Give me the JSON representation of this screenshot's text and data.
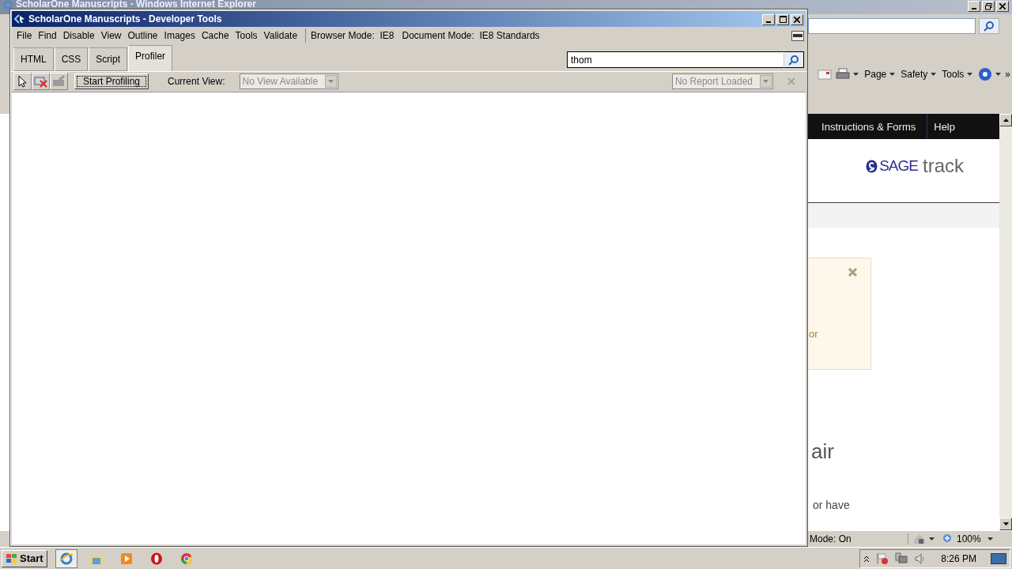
{
  "ie": {
    "title": "ScholarOne Manuscripts - Windows Internet Explorer",
    "command_bar": [
      {
        "label": "Page"
      },
      {
        "label": "Safety"
      },
      {
        "label": "Tools"
      }
    ],
    "overflow": "»",
    "nav": [
      "Instructions & Forms",
      "Help"
    ],
    "logo": {
      "mark": "SAGE",
      "word": "track"
    },
    "notice": {
      "text": "or"
    },
    "heading": "air",
    "body": "or have",
    "status": {
      "mode": "Mode: On",
      "zoom": "100%"
    }
  },
  "devtools": {
    "title": "ScholarOne Manuscripts - Developer Tools",
    "menu": [
      "File",
      "Find",
      "Disable",
      "View",
      "Outline",
      "Images",
      "Cache",
      "Tools",
      "Validate"
    ],
    "browser_mode": "Browser Mode:  IE8",
    "document_mode": "Document Mode:  IE8 Standards",
    "tabs": [
      {
        "label": "HTML",
        "selected": false
      },
      {
        "label": "CSS",
        "selected": false
      },
      {
        "label": "Script",
        "selected": false
      },
      {
        "label": "Profiler",
        "selected": true
      }
    ],
    "search": {
      "value": "thom"
    },
    "toolbar": {
      "start": "Start Profiling",
      "current_view_label": "Current View:",
      "view_select": {
        "value": "No View Available",
        "disabled": true
      },
      "report_select": {
        "value": "No Report Loaded",
        "disabled": true
      }
    }
  },
  "taskbar": {
    "start": "Start",
    "clock": "8:26 PM"
  }
}
